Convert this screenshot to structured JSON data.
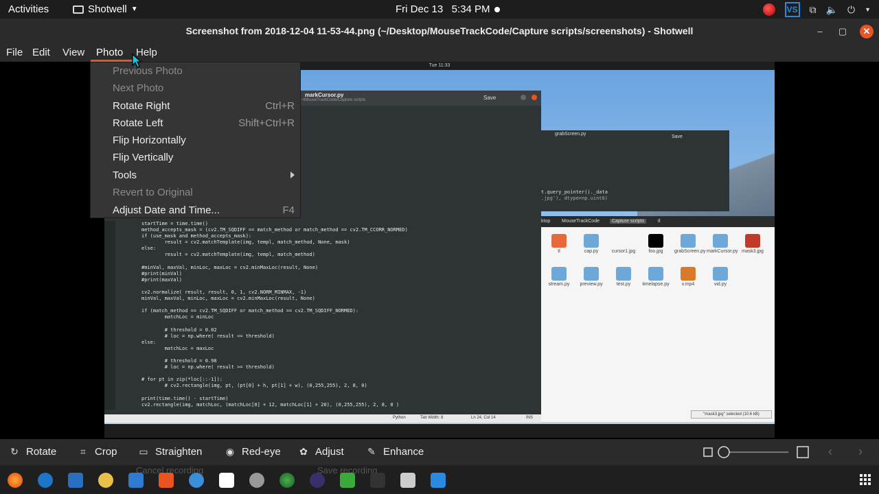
{
  "topbar": {
    "activities": "Activities",
    "app_name": "Shotwell",
    "datetime": "Fri Dec 13   5:34 PM",
    "tray_vs_label": "VS"
  },
  "window": {
    "title": "Screenshot from 2018-12-04 11-53-44.png (~/Desktop/MouseTrackCode/Capture scripts/screenshots) - Shotwell",
    "minimize_glyph": "–",
    "maximize_glyph": "▢",
    "close_glyph": "✕"
  },
  "menubar": {
    "items": [
      "File",
      "Edit",
      "View",
      "Photo",
      "Help"
    ]
  },
  "photo_menu": {
    "items": [
      {
        "label": "Previous Photo",
        "accel": "",
        "disabled": true
      },
      {
        "label": "Next Photo",
        "accel": "",
        "disabled": true
      },
      {
        "label": "Rotate Right",
        "accel": "Ctrl+R",
        "disabled": false
      },
      {
        "label": "Rotate Left",
        "accel": "Shift+Ctrl+R",
        "disabled": false
      },
      {
        "label": "Flip Horizontally",
        "accel": "",
        "disabled": false
      },
      {
        "label": "Flip Vertically",
        "accel": "",
        "disabled": false
      },
      {
        "label": "Tools",
        "accel": "",
        "disabled": false,
        "submenu": true
      },
      {
        "label": "Revert to Original",
        "accel": "",
        "disabled": true
      },
      {
        "label": "Adjust Date and Time...",
        "accel": "F4",
        "disabled": false
      }
    ]
  },
  "photo_content": {
    "inner_clock": "Tue 11:33",
    "editor_filename": "markCursor.py",
    "editor_path": "~/MouseTrackCode/Capture scripts",
    "editor_save": "Save",
    "grab_filename": "grabScreen.py",
    "grab_save": "Save",
    "grab_code_1": "t.query_pointer()._data",
    "grab_code_2": ".jpg'), dtype=np.uint8)",
    "code_lines": [
      "startTime = time.time()",
      "method_accepts_mask = (cv2.TM_SQDIFF == match_method or match_method == cv2.TM_CCORR_NORMED)",
      "if (use_mask and method_accepts_mask):",
      "        result = cv2.matchTemplate(img, templ, match_method, None, mask)",
      "else:",
      "        result = cv2.matchTemplate(img, templ, match_method)",
      "",
      "#minVal, maxVal, minLoc, maxLoc = cv2.minMaxLoc(result, None)",
      "#print(minVal)",
      "#print(maxVal)",
      "",
      "cv2.normalize( result, result, 0, 1, cv2.NORM_MINMAX, -1)",
      "minVal, maxVal, minLoc, maxLoc = cv2.minMaxLoc(result, None)",
      "",
      "if (match_method == cv2.TM_SQDIFF or match_method == cv2.TM_SQDIFF_NORMED):",
      "        matchLoc = minLoc",
      "",
      "        # threshold = 0.02",
      "        # loc = np.where( result <= threshold)",
      "else:",
      "        matchLoc = maxLoc",
      "",
      "        # threshold = 0.98",
      "        # loc = np.where( result >= threshold)",
      "",
      "# for pt in zip(*loc[::-1]):",
      "        # cv2.rectangle(img, pt, (pt[0] + h, pt[1] + w), (0,255,255), 2, 8, 0)",
      "",
      "print(time.time() - startTime)",
      "cv2.rectangle(img, matchLoc, (matchLoc[0] + 12, matchLoc[1] + 20), (0,255,255), 2, 8, 0 )"
    ],
    "editor_status": {
      "language": "Python",
      "tab_width": "Tab Width: 8",
      "position": "Ln 24, Col 14",
      "mode": "INS"
    },
    "files_breadcrumb": [
      "ktop",
      "MouseTrackCode",
      "Capture scripts",
      "tl"
    ],
    "files": [
      {
        "name": "tl",
        "color": "#e8683a"
      },
      {
        "name": "cap.py",
        "color": "#6ea8d8"
      },
      {
        "name": "cursor1.jpg",
        "color": "#f5f5f5"
      },
      {
        "name": "foo.jpg",
        "color": "#000000"
      },
      {
        "name": "grabScreen.py",
        "color": "#6ea8d8"
      },
      {
        "name": "markCursor.py",
        "color": "#6ea8d8"
      },
      {
        "name": "mask3.jpg",
        "color": "#c0392b"
      },
      {
        "name": "stream.py",
        "color": "#6ea8d8"
      },
      {
        "name": "preview.py",
        "color": "#6ea8d8"
      },
      {
        "name": "test.py",
        "color": "#6ea8d8"
      },
      {
        "name": "timelapse.py",
        "color": "#6ea8d8"
      },
      {
        "name": "v.mp4",
        "color": "#d97a2a"
      },
      {
        "name": "vid.py",
        "color": "#6ea8d8"
      }
    ],
    "selected_note": "\"mask3.jpg\" selected (10.6 kB)"
  },
  "toolbar": {
    "rotate": "Rotate",
    "crop": "Crop",
    "straighten": "Straighten",
    "redeye": "Red-eye",
    "adjust": "Adjust",
    "enhance": "Enhance",
    "zoom_level": 0.0
  },
  "taskbar": {
    "ghost_cancel": "Cancel recording",
    "ghost_save": "Save recording"
  },
  "colors": {
    "accent": "#e95420",
    "menu_bg": "#353535",
    "panel_bg": "#2b2b2b"
  }
}
